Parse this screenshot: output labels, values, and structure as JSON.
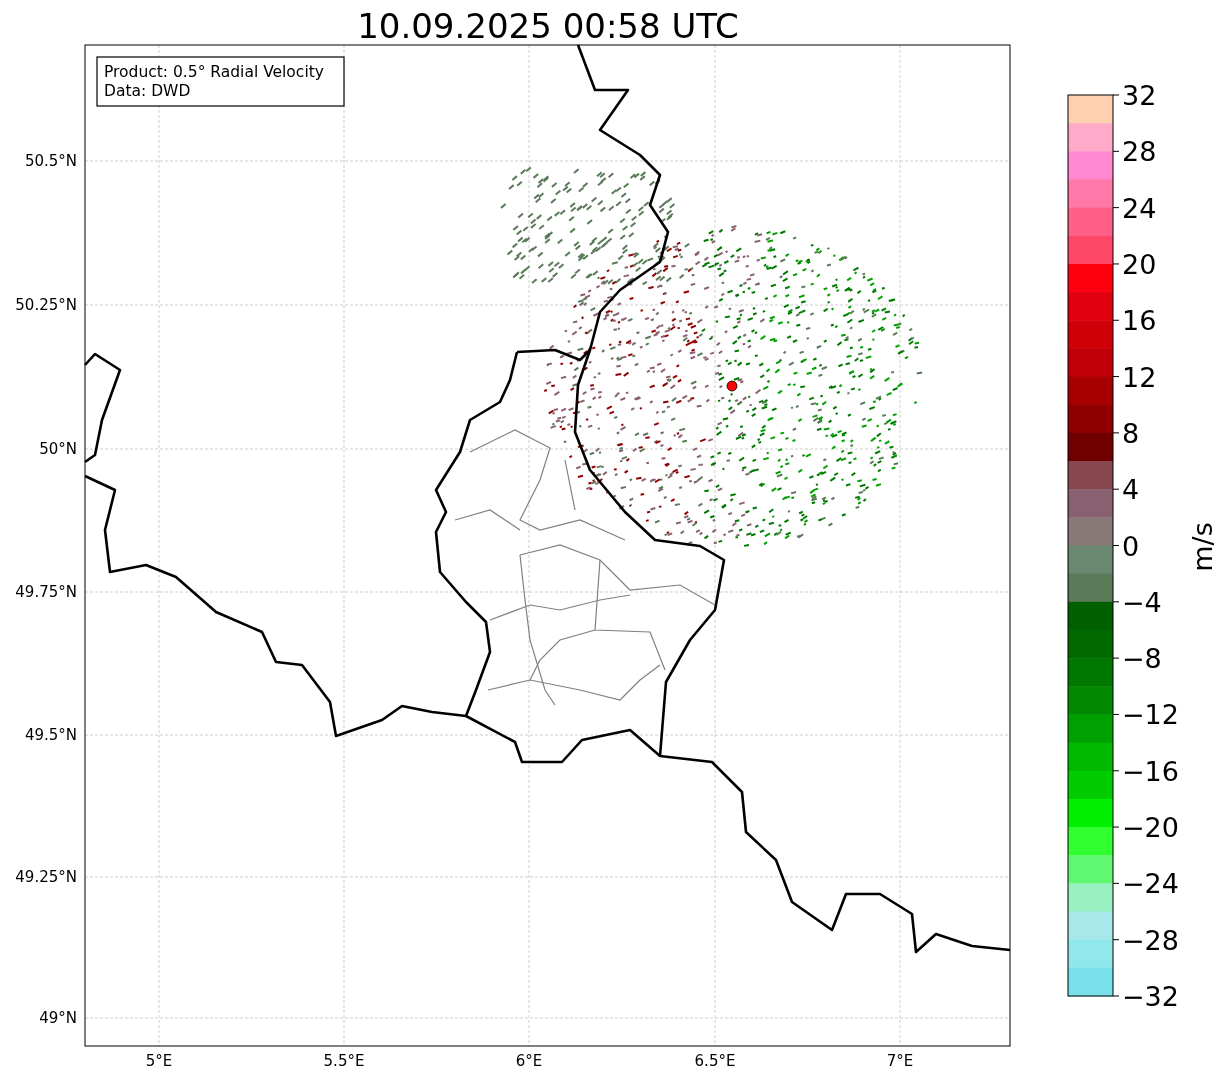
{
  "title": "10.09.2025 00:58 UTC",
  "info_box": [
    "Product: 0.5° Radial Velocity",
    "Data: DWD"
  ],
  "x_tick_labels": [
    "5°E",
    "5.5°E",
    "6°E",
    "6.5°E",
    "7°E"
  ],
  "y_tick_labels": [
    "50.5°N",
    "50.25°N",
    "50°N",
    "49.75°N",
    "49.5°N",
    "49.25°N",
    "49°N"
  ],
  "colorbar": {
    "label": "m/s",
    "tick_labels": [
      "32",
      "28",
      "24",
      "20",
      "16",
      "12",
      "8",
      "4",
      "0",
      "−4",
      "−8",
      "−12",
      "−16",
      "−20",
      "−24",
      "−28",
      "−32"
    ],
    "bands": [
      {
        "color": "#ffd0b0"
      },
      {
        "color": "#ffaac8"
      },
      {
        "color": "#ff88d0"
      },
      {
        "color": "#ff78a8"
      },
      {
        "color": "#ff6088"
      },
      {
        "color": "#ff4868"
      },
      {
        "color": "#ff0010"
      },
      {
        "color": "#e00010"
      },
      {
        "color": "#d00008"
      },
      {
        "color": "#c00008"
      },
      {
        "color": "#a80000"
      },
      {
        "color": "#900000"
      },
      {
        "color": "#700000"
      },
      {
        "color": "#884850"
      },
      {
        "color": "#886070"
      },
      {
        "color": "#887878"
      },
      {
        "color": "#6a8870"
      },
      {
        "color": "#5a7a58"
      },
      {
        "color": "#006000"
      },
      {
        "color": "#006a00"
      },
      {
        "color": "#007800"
      },
      {
        "color": "#008800"
      },
      {
        "color": "#00a000"
      },
      {
        "color": "#00b800"
      },
      {
        "color": "#00cc00"
      },
      {
        "color": "#00f000"
      },
      {
        "color": "#30ff30"
      },
      {
        "color": "#60f870"
      },
      {
        "color": "#98f0c0"
      },
      {
        "color": "#a8e8ea"
      },
      {
        "color": "#90e8ea"
      },
      {
        "color": "#78e0e8"
      }
    ]
  }
}
